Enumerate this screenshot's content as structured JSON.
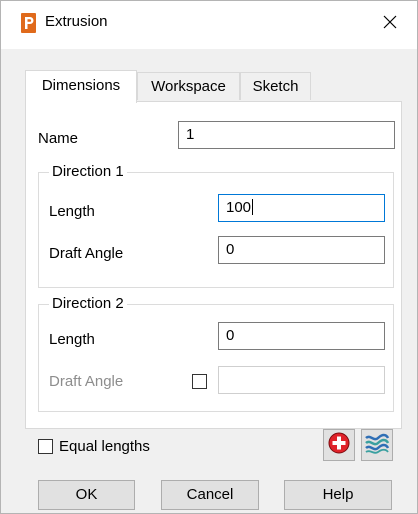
{
  "window": {
    "title": "Extrusion",
    "app_icon": "p-logo-icon",
    "close_icon": "close-icon",
    "accent_color": "#e06a1b"
  },
  "tabs": [
    {
      "label": "Dimensions",
      "active": true
    },
    {
      "label": "Workspace",
      "active": false
    },
    {
      "label": "Sketch",
      "active": false
    }
  ],
  "form": {
    "name_label": "Name",
    "name_value": "1",
    "direction1": {
      "legend": "Direction 1",
      "length_label": "Length",
      "length_value": "100",
      "draft_label": "Draft Angle",
      "draft_value": "0"
    },
    "direction2": {
      "legend": "Direction 2",
      "length_label": "Length",
      "length_value": "0",
      "draft_label": "Draft Angle",
      "draft_value": ""
    },
    "equal_lengths_label": "Equal lengths",
    "equal_lengths_checked": false,
    "tool_icons": [
      "add-red-cross-icon",
      "wave-surface-icon"
    ]
  },
  "buttons": {
    "ok": "OK",
    "cancel": "Cancel",
    "help": "Help"
  }
}
